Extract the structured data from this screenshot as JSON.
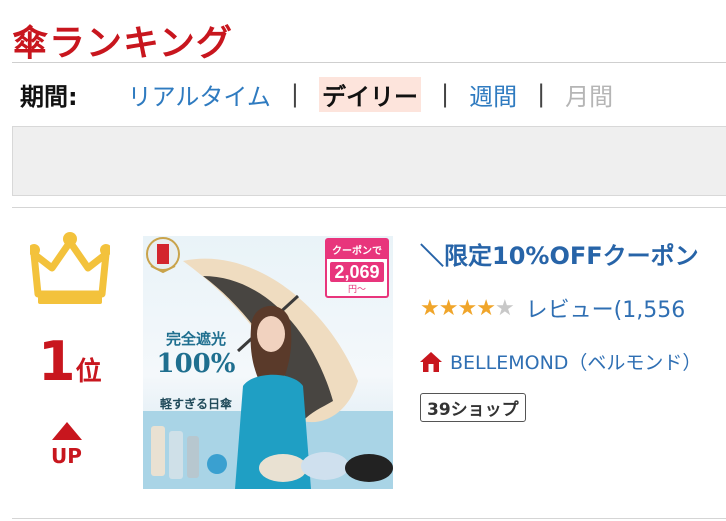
{
  "page_title": "傘ランキング",
  "period": {
    "label": "期間:",
    "tabs": [
      {
        "label": "リアルタイム",
        "state": "link"
      },
      {
        "label": "デイリー",
        "state": "active"
      },
      {
        "label": "週間",
        "state": "link"
      },
      {
        "label": "月間",
        "state": "disabled"
      }
    ],
    "separator": "|"
  },
  "item": {
    "rank_number": "1",
    "rank_suffix": "位",
    "trend_label": "UP",
    "thumbnail": {
      "coupon_tag": "クーポンで",
      "coupon_price": "2,069",
      "coupon_unit": "円〜",
      "copy_line1": "完全遮光",
      "copy_line2": "100%",
      "copy_line3": "軽すぎる日傘"
    },
    "title": "＼限定10%OFFクーポン",
    "rating": {
      "stars_filled": 4,
      "stars_total": 5
    },
    "review_text": "レビュー(1,556",
    "shop_name": "BELLEMOND（ベルモンド）",
    "shop_badge": "39ショップ"
  },
  "colors": {
    "brand_red": "#c8161e",
    "link_blue": "#2f7bc0",
    "active_tab_bg": "#fde4dc",
    "crown_gold": "#f3c23c",
    "star_gold": "#f0a52a",
    "coupon_pink": "#e8357c"
  },
  "icons": {
    "crown": "crown-icon",
    "trend": "up-arrow-icon",
    "shop": "house-icon"
  }
}
